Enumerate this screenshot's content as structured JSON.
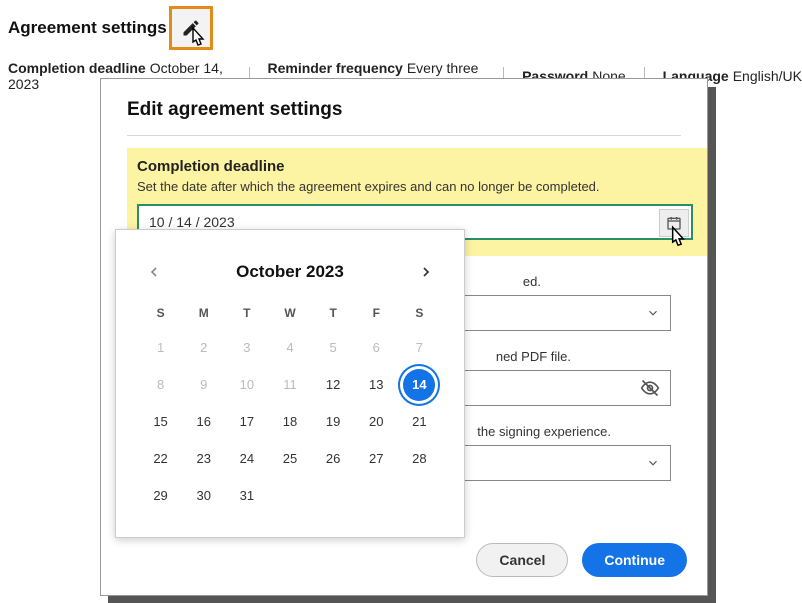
{
  "page": {
    "title": "Agreement settings"
  },
  "summary": {
    "completion_label": "Completion deadline",
    "completion_value": "October 14, 2023",
    "reminder_label": "Reminder frequency",
    "reminder_value": "Every three days",
    "password_label": "Password",
    "password_value": "None",
    "language_label": "Language",
    "language_value": "English/UK"
  },
  "modal": {
    "title": "Edit agreement settings",
    "deadline": {
      "title": "Completion deadline",
      "desc": "Set the date after which the agreement expires and can no longer be completed.",
      "value": "10 / 14 / 2023"
    },
    "reminder": {
      "desc_suffix": "ed."
    },
    "pdf": {
      "desc_suffix": "ned PDF file."
    },
    "lang": {
      "desc_suffix": "the signing experience."
    },
    "cancel": "Cancel",
    "continue": "Continue"
  },
  "calendar": {
    "month_label": "October 2023",
    "dow": [
      "S",
      "M",
      "T",
      "W",
      "T",
      "F",
      "S"
    ],
    "cells": [
      {
        "n": "1",
        "dim": true
      },
      {
        "n": "2",
        "dim": true
      },
      {
        "n": "3",
        "dim": true
      },
      {
        "n": "4",
        "dim": true
      },
      {
        "n": "5",
        "dim": true
      },
      {
        "n": "6",
        "dim": true
      },
      {
        "n": "7",
        "dim": true
      },
      {
        "n": "8",
        "dim": true
      },
      {
        "n": "9",
        "dim": true
      },
      {
        "n": "10",
        "dim": true
      },
      {
        "n": "11",
        "dim": true
      },
      {
        "n": "12",
        "dim": false
      },
      {
        "n": "13",
        "dim": false
      },
      {
        "n": "14",
        "dim": false,
        "sel": true
      },
      {
        "n": "15",
        "dim": false
      },
      {
        "n": "16",
        "dim": false
      },
      {
        "n": "17",
        "dim": false
      },
      {
        "n": "18",
        "dim": false
      },
      {
        "n": "19",
        "dim": false
      },
      {
        "n": "20",
        "dim": false
      },
      {
        "n": "21",
        "dim": false
      },
      {
        "n": "22",
        "dim": false
      },
      {
        "n": "23",
        "dim": false
      },
      {
        "n": "24",
        "dim": false
      },
      {
        "n": "25",
        "dim": false
      },
      {
        "n": "26",
        "dim": false
      },
      {
        "n": "27",
        "dim": false
      },
      {
        "n": "28",
        "dim": false
      },
      {
        "n": "29",
        "dim": false
      },
      {
        "n": "30",
        "dim": false
      },
      {
        "n": "31",
        "dim": false
      }
    ]
  }
}
